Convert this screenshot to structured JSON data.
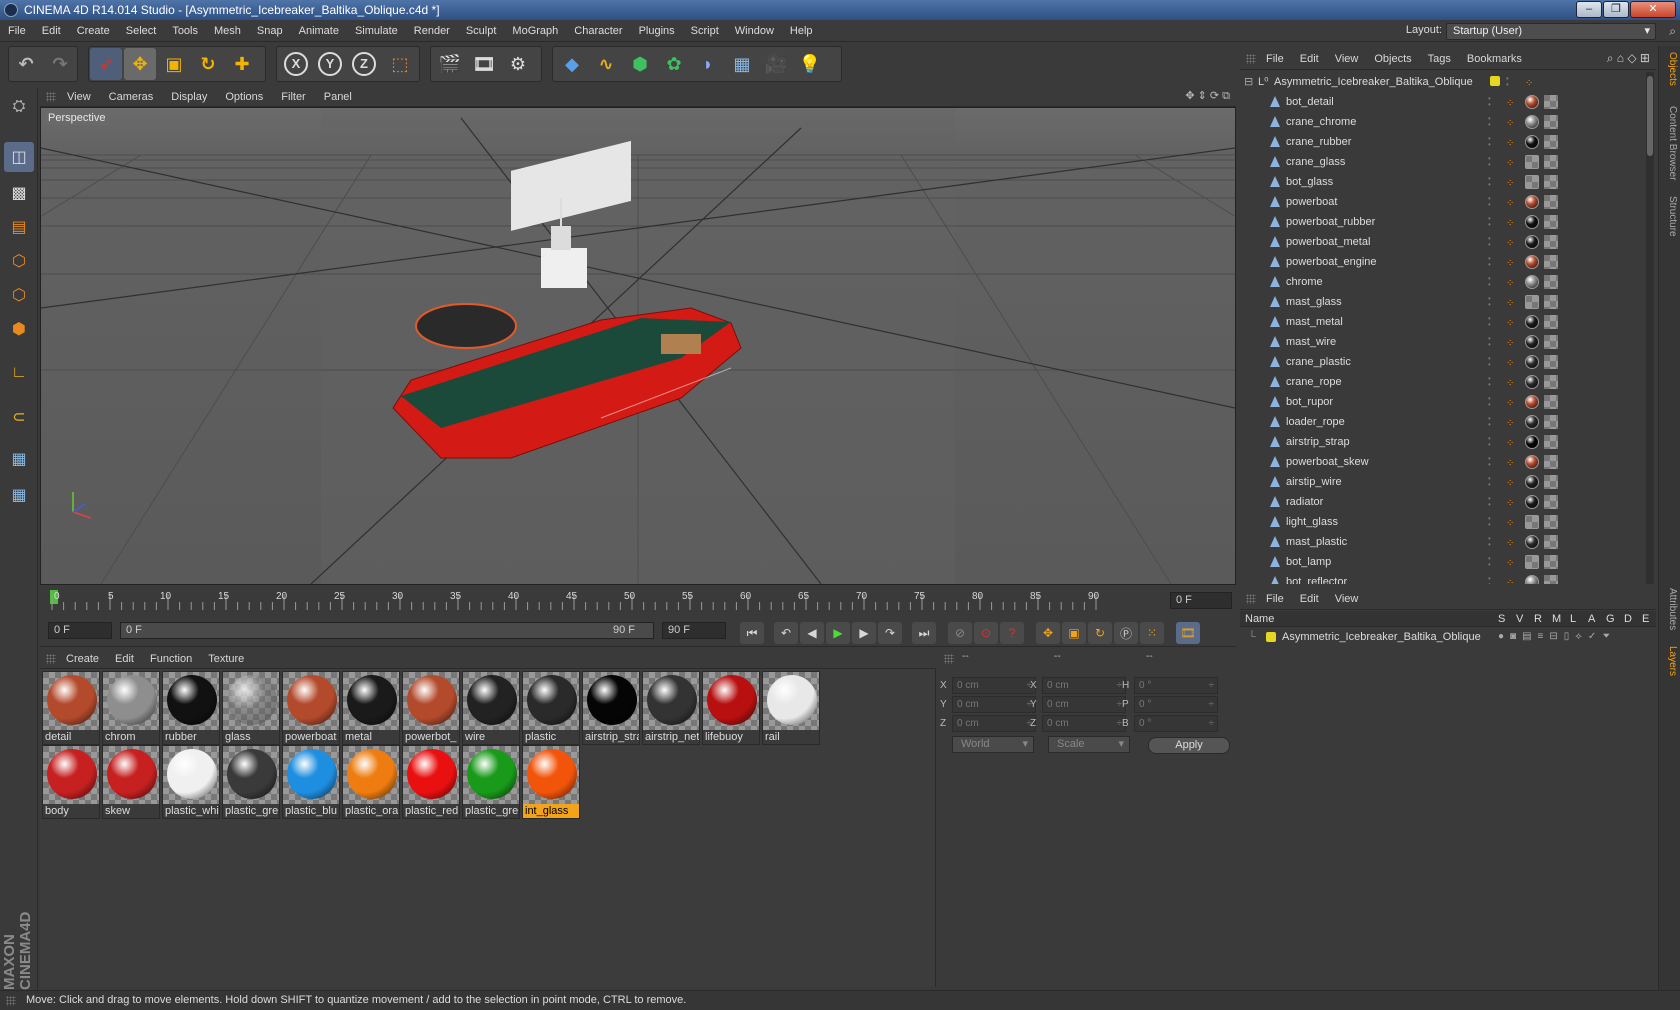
{
  "window": {
    "title": "CINEMA 4D R14.014 Studio - [Asymmetric_Icebreaker_Baltika_Oblique.c4d *]",
    "buttons": [
      "–",
      "❐",
      "✕"
    ]
  },
  "menubar": [
    "File",
    "Edit",
    "Create",
    "Select",
    "Tools",
    "Mesh",
    "Snap",
    "Animate",
    "Simulate",
    "Render",
    "Sculpt",
    "MoGraph",
    "Character",
    "Plugins",
    "Script",
    "Window",
    "Help"
  ],
  "layout": {
    "label": "Layout:",
    "value": "Startup (User)"
  },
  "toolbar": {
    "axis_x": "X",
    "axis_y": "Y",
    "axis_z": "Z"
  },
  "viewport": {
    "menu": [
      "View",
      "Cameras",
      "Display",
      "Options",
      "Filter",
      "Panel"
    ],
    "label": "Perspective"
  },
  "timeline": {
    "ticks": [
      "0",
      "5",
      "10",
      "15",
      "20",
      "25",
      "30",
      "35",
      "40",
      "45",
      "50",
      "55",
      "60",
      "65",
      "70",
      "75",
      "80",
      "85",
      "90"
    ],
    "current_frame": "0 F"
  },
  "transport": {
    "start": "0 F",
    "range_start": "0 F",
    "range_end": "90 F",
    "end": "90 F"
  },
  "materials": {
    "menu": [
      "Create",
      "Edit",
      "Function",
      "Texture"
    ],
    "items": [
      {
        "name": "detail",
        "color": "#b34a2c"
      },
      {
        "name": "chrom",
        "color": "#8e8e8e"
      },
      {
        "name": "rubber",
        "color": "#111111"
      },
      {
        "name": "glass",
        "color": "#888888"
      },
      {
        "name": "powerboat",
        "color": "#b34a2c"
      },
      {
        "name": "metal",
        "color": "#1a1a1a"
      },
      {
        "name": "powerbot_",
        "color": "#b34a2c"
      },
      {
        "name": "wire",
        "color": "#222222"
      },
      {
        "name": "plastic",
        "color": "#2a2a2a"
      },
      {
        "name": "airstrip_stra",
        "color": "#050505"
      },
      {
        "name": "airstrip_net",
        "color": "#333333"
      },
      {
        "name": "lifebuoy",
        "color": "#b81010"
      },
      {
        "name": "rail",
        "color": "#e8e8e8"
      },
      {
        "name": "body",
        "color": "#c62020"
      },
      {
        "name": "skew",
        "color": "#c62020"
      },
      {
        "name": "plastic_whi",
        "color": "#f0f0f0"
      },
      {
        "name": "plastic_gre",
        "color": "#3a3a3a"
      },
      {
        "name": "plastic_blu",
        "color": "#1e8ee0"
      },
      {
        "name": "plastic_ora",
        "color": "#ef7c10"
      },
      {
        "name": "plastic_red",
        "color": "#ea1010"
      },
      {
        "name": "plastic_gre",
        "color": "#1a9a1a"
      },
      {
        "name": "int_glass",
        "color": "#f2540a"
      }
    ]
  },
  "coords": {
    "headers": [
      "--",
      "--",
      "--"
    ],
    "rows": [
      {
        "a": "X",
        "av": "0 cm",
        "b": "X",
        "bv": "0 cm",
        "c": "H",
        "cv": "0 °"
      },
      {
        "a": "Y",
        "av": "0 cm",
        "b": "Y",
        "bv": "0 cm",
        "c": "P",
        "cv": "0 °"
      },
      {
        "a": "Z",
        "av": "0 cm",
        "b": "Z",
        "bv": "0 cm",
        "c": "B",
        "cv": "0 °"
      }
    ],
    "world": "World",
    "scale": "Scale",
    "apply": "Apply"
  },
  "objects": {
    "menu": [
      "File",
      "Edit",
      "View",
      "Objects",
      "Tags",
      "Bookmarks"
    ],
    "root": "Asymmetric_Icebreaker_Baltika_Oblique",
    "items": [
      {
        "name": "bot_detail",
        "mat": "#b34a2c"
      },
      {
        "name": "crane_chrome",
        "mat": "#8e8e8e"
      },
      {
        "name": "crane_rubber",
        "mat": "#111111"
      },
      {
        "name": "crane_glass",
        "mat": "checker"
      },
      {
        "name": "bot_glass",
        "mat": "checker"
      },
      {
        "name": "powerboat",
        "mat": "#b34a2c"
      },
      {
        "name": "powerboat_rubber",
        "mat": "#111111"
      },
      {
        "name": "powerboat_metal",
        "mat": "#1a1a1a"
      },
      {
        "name": "powerboat_engine",
        "mat": "#b34a2c"
      },
      {
        "name": "chrome",
        "mat": "#8e8e8e"
      },
      {
        "name": "mast_glass",
        "mat": "checker"
      },
      {
        "name": "mast_metal",
        "mat": "#1a1a1a"
      },
      {
        "name": "mast_wire",
        "mat": "#222222"
      },
      {
        "name": "crane_plastic",
        "mat": "#2a2a2a"
      },
      {
        "name": "crane_rope",
        "mat": "#2a2a2a"
      },
      {
        "name": "bot_rupor",
        "mat": "#b34a2c"
      },
      {
        "name": "loader_rope",
        "mat": "#2a2a2a"
      },
      {
        "name": "airstrip_strap",
        "mat": "#050505"
      },
      {
        "name": "powerboat_skew",
        "mat": "#b34a2c"
      },
      {
        "name": "airstip_wire",
        "mat": "#222222"
      },
      {
        "name": "radiator",
        "mat": "#1a1a1a"
      },
      {
        "name": "light_glass",
        "mat": "checker"
      },
      {
        "name": "mast_plastic",
        "mat": "#2a2a2a"
      },
      {
        "name": "bot_lamp",
        "mat": "checker"
      },
      {
        "name": "bot_reflector",
        "mat": "#8e8e8e"
      }
    ]
  },
  "side_tabs": [
    "Objects",
    "Content Browser",
    "Structure",
    "Attributes",
    "Layers"
  ],
  "layers": {
    "menu": [
      "File",
      "Edit",
      "View"
    ],
    "cols": [
      "Name",
      "S",
      "V",
      "R",
      "M",
      "L",
      "A",
      "G",
      "D",
      "E"
    ],
    "root": "Asymmetric_Icebreaker_Baltika_Oblique"
  },
  "status": "Move: Click and drag to move elements. Hold down SHIFT to quantize movement / add to the selection in point mode, CTRL to remove."
}
